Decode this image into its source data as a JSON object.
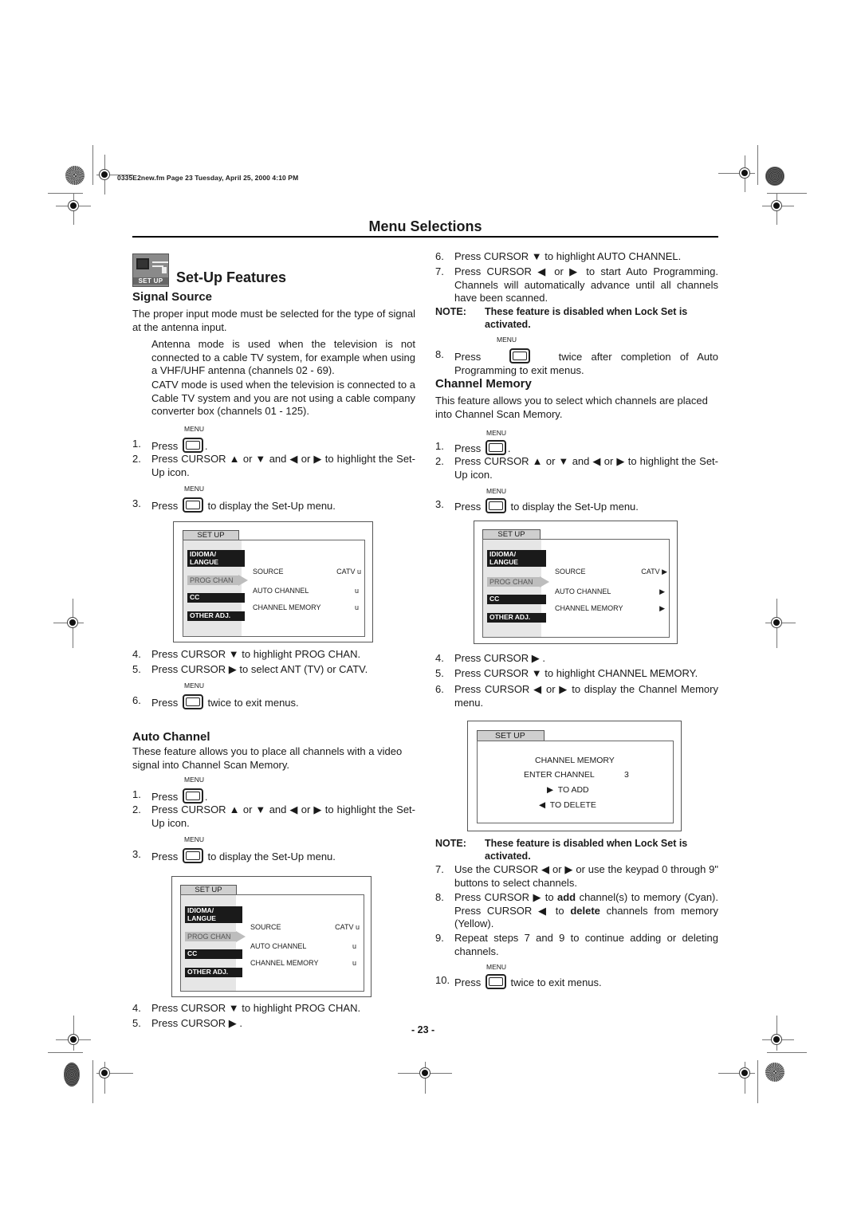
{
  "header": {
    "file_info": "0335E2new.fm  Page 23  Tuesday, April 25, 2000  4:10 PM",
    "page_title": "Menu Selections"
  },
  "icons": {
    "registration_mark": "crosshair-circle",
    "starburst": "color-registration-wheel",
    "menu_button": "rounded-rect-button",
    "cursor_up": "▲",
    "cursor_down": "▼",
    "cursor_left": "◀",
    "cursor_right": "▶"
  },
  "section": {
    "icon_label": "SET UP",
    "title": "Set-Up Features"
  },
  "menu_key_label": "MENU",
  "signal_source": {
    "heading": "Signal Source",
    "intro": "The proper input mode must be selected for the type of signal at the antenna input.",
    "antenna_para": "Antenna mode is used when the television is not connected to a cable TV system, for example when using a VHF/UHF antenna (channels 02 - 69).",
    "catv_para": "CATV mode is used when the television is connected to a Cable TV system and you are not using a cable company converter box (channels 01 - 125).",
    "steps": [
      {
        "num": "1.",
        "before": "Press",
        "after": "."
      },
      {
        "num": "2.",
        "text": "Press CURSOR ▲ or ▼ and ◀ or ▶ to highlight the Set-Up icon."
      },
      {
        "num": "3.",
        "before": "Press",
        "after": "to display the Set-Up menu."
      },
      {
        "num": "4.",
        "text": "Press CURSOR ▼ to highlight PROG CHAN."
      },
      {
        "num": "5.",
        "text": "Press CURSOR ▶ to select ANT (TV) or CATV."
      },
      {
        "num": "6.",
        "before": "Press",
        "after": "twice to exit menus."
      }
    ],
    "screen": {
      "tab": "SET UP",
      "side_items": [
        "IDIOMA/\nLANGUE",
        "PROG CHAN",
        "CC",
        "OTHER ADJ."
      ],
      "rows": [
        {
          "label": "SOURCE",
          "value": "CATV u"
        },
        {
          "label": "AUTO CHANNEL",
          "value": "u"
        },
        {
          "label": "CHANNEL MEMORY",
          "value": "u"
        }
      ]
    }
  },
  "auto_channel": {
    "heading": "Auto Channel",
    "intro": "These feature allows you to place all channels with a video signal into Channel Scan Memory.",
    "steps_left": [
      {
        "num": "1.",
        "before": "Press",
        "after": "."
      },
      {
        "num": "2.",
        "text": "Press CURSOR ▲ or ▼ and ◀ or ▶ to highlight the Set-Up icon."
      },
      {
        "num": "3.",
        "before": "Press",
        "after": "to display the Set-Up menu."
      },
      {
        "num": "4.",
        "text": "Press CURSOR ▼ to highlight PROG CHAN."
      },
      {
        "num": "5.",
        "text": "Press CURSOR ▶ ."
      }
    ],
    "screen": {
      "tab": "SET UP",
      "side_items": [
        "IDIOMA/\nLANGUE",
        "PROG CHAN",
        "CC",
        "OTHER ADJ."
      ],
      "rows": [
        {
          "label": "SOURCE",
          "value": "CATV u"
        },
        {
          "label": "AUTO CHANNEL",
          "value": "u"
        },
        {
          "label": "CHANNEL MEMORY",
          "value": "u"
        }
      ]
    },
    "steps_right": [
      {
        "num": "6.",
        "text": "Press CURSOR ▼ to highlight AUTO CHANNEL."
      },
      {
        "num": "7.",
        "text": "Press CURSOR ◀ or ▶ to start Auto Programming. Channels will automatically advance until all channels have been scanned."
      }
    ],
    "note_label": "NOTE:",
    "note_text": "These feature is disabled when Lock Set is activated.",
    "step8": {
      "num": "8.",
      "before": "Press",
      "after": "twice after completion of Auto Programming to exit menus."
    }
  },
  "channel_memory": {
    "heading": "Channel Memory",
    "intro": "This feature allows you to select which channels are placed into Channel Scan Memory.",
    "steps_a": [
      {
        "num": "1.",
        "before": "Press",
        "after": "."
      },
      {
        "num": "2.",
        "text": "Press CURSOR ▲ or ▼ and ◀ or ▶ to highlight the Set-Up icon."
      },
      {
        "num": "3.",
        "before": "Press",
        "after": "to display the Set-Up menu."
      }
    ],
    "screen1": {
      "tab": "SET UP",
      "side_items": [
        "IDIOMA/\nLANGUE",
        "PROG CHAN",
        "CC",
        "OTHER ADJ."
      ],
      "rows": [
        {
          "label": "SOURCE",
          "value": "CATV ▶"
        },
        {
          "label": "AUTO CHANNEL",
          "value": "▶"
        },
        {
          "label": "CHANNEL MEMORY",
          "value": "▶"
        }
      ]
    },
    "steps_b": [
      {
        "num": "4.",
        "text": "Press CURSOR ▶ ."
      },
      {
        "num": "5.",
        "text": "Press CURSOR ▼ to highlight CHANNEL MEMORY."
      },
      {
        "num": "6.",
        "text": "Press CURSOR ◀ or ▶ to display the Channel Memory menu."
      }
    ],
    "screen2": {
      "tab": "SET UP",
      "title": "CHANNEL MEMORY",
      "enter_label": "ENTER CHANNEL",
      "enter_value": "3",
      "add": "▶  TO ADD",
      "delete": "◀  TO DELETE"
    },
    "note_label": "NOTE:",
    "note_text": "These feature is disabled when Lock Set is activated.",
    "steps_c": [
      {
        "num": "7.",
        "text": "Use the CURSOR ◀ or ▶ or use the keypad  0 through 9\" buttons to select channels."
      },
      {
        "num": "8.",
        "pre": "Press CURSOR ▶ to ",
        "bold1": "add",
        "mid": " channel(s) to memory (Cyan). Press CURSOR ◀ to ",
        "bold2": "delete",
        "post": " channels from memory (Yellow)."
      },
      {
        "num": "9.",
        "text": "Repeat steps 7 and 9 to continue adding or deleting channels."
      }
    ],
    "step10": {
      "num": "10.",
      "before": "Press",
      "after": "twice to exit menus."
    }
  },
  "footer": {
    "page_number": "- 23 -"
  }
}
